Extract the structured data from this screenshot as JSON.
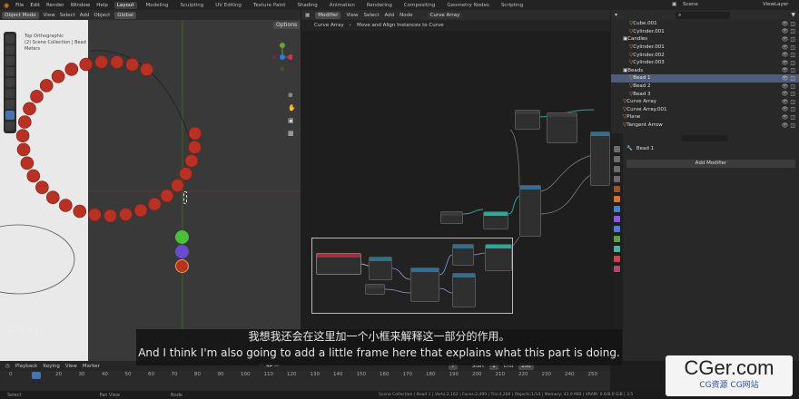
{
  "menubar": {
    "menus": [
      "File",
      "Edit",
      "Render",
      "Window",
      "Help"
    ],
    "workspaces": [
      "Layout",
      "Modeling",
      "Sculpting",
      "UV Editing",
      "Texture Paint",
      "Shading",
      "Animation",
      "Rendering",
      "Compositing",
      "Geometry Nodes",
      "Scripting"
    ],
    "scene": "Scene",
    "view_layer": "ViewLayer"
  },
  "viewport": {
    "mode": "Object Mode",
    "menus": [
      "View",
      "Select",
      "Add",
      "Object"
    ],
    "orientation": "Global",
    "options": "Options",
    "overlay_text": [
      "Top Orthographic",
      "(2) Scene Collection | Bead 1",
      "Meters"
    ],
    "shortcut_hint": "Ctrl + J",
    "gizmo_axes": [
      "X",
      "Y",
      "Z"
    ]
  },
  "node_editor": {
    "editor_type": "Modifier",
    "menus": [
      "View",
      "Select",
      "Add",
      "Node"
    ],
    "tree_name": "Curve Array",
    "breadcrumb": [
      "Curve Array",
      "Move and Align Instances to Curve"
    ]
  },
  "outliner": {
    "search_placeholder": "",
    "rows": [
      {
        "name": "Cube.001",
        "indent": 2,
        "selected": false
      },
      {
        "name": "Cylinder.001",
        "indent": 2,
        "selected": false
      },
      {
        "name": "Candles",
        "indent": 1,
        "selected": false
      },
      {
        "name": "Cylinder.001",
        "indent": 2,
        "selected": false
      },
      {
        "name": "Cylinder.002",
        "indent": 2,
        "selected": false
      },
      {
        "name": "Cylinder.003",
        "indent": 2,
        "selected": false
      },
      {
        "name": "Beads",
        "indent": 1,
        "selected": false
      },
      {
        "name": "Bead 1",
        "indent": 2,
        "selected": true
      },
      {
        "name": "Bead 2",
        "indent": 2,
        "selected": false
      },
      {
        "name": "Bead 3",
        "indent": 2,
        "selected": false
      },
      {
        "name": "Curve Array",
        "indent": 1,
        "selected": false
      },
      {
        "name": "Curve Array.001",
        "indent": 1,
        "selected": false
      },
      {
        "name": "Plane",
        "indent": 1,
        "selected": false
      },
      {
        "name": "Tangent Arrow",
        "indent": 1,
        "selected": false
      }
    ]
  },
  "properties": {
    "object_name": "Bead 1",
    "add_modifier": "Add Modifier"
  },
  "timeline": {
    "menus": [
      "Playback",
      "Keying",
      "View",
      "Marker"
    ],
    "current_frame": "7",
    "start_label": "Start",
    "start_value": "1",
    "end_label": "End",
    "end_value": "250",
    "ticks": [
      "0",
      "10",
      "20",
      "30",
      "40",
      "50",
      "60",
      "70",
      "80",
      "90",
      "100",
      "110",
      "120",
      "130",
      "140",
      "150",
      "160",
      "170",
      "180",
      "190",
      "200",
      "210",
      "220",
      "230",
      "240",
      "250"
    ]
  },
  "statusbar": {
    "items": [
      "Select",
      "Pan View",
      "Node"
    ],
    "info": "Scene Collection | Bead 1 | Verts:2,162 | Faces:2,499 | Tris:4,266 | Objects:1/14 | Memory: 43.0 MiB | VRAM: 0.6/8.0 GiB | 3.5"
  },
  "subtitles": {
    "zh": "我想我还会在这里加一个小框来解释这一部分的作用。",
    "en": "And I think I'm also going to add a little frame here that explains what this part is doing."
  },
  "watermark": {
    "brand": "CGer.com",
    "tagline": "CG资源 CG网站"
  },
  "colors": {
    "bead_red": "#b73225",
    "bead_green": "#4cbf3a",
    "bead_purple": "#6a4bd0",
    "select_blue": "#4f5d7a",
    "node_teal": "#2aa89a"
  }
}
